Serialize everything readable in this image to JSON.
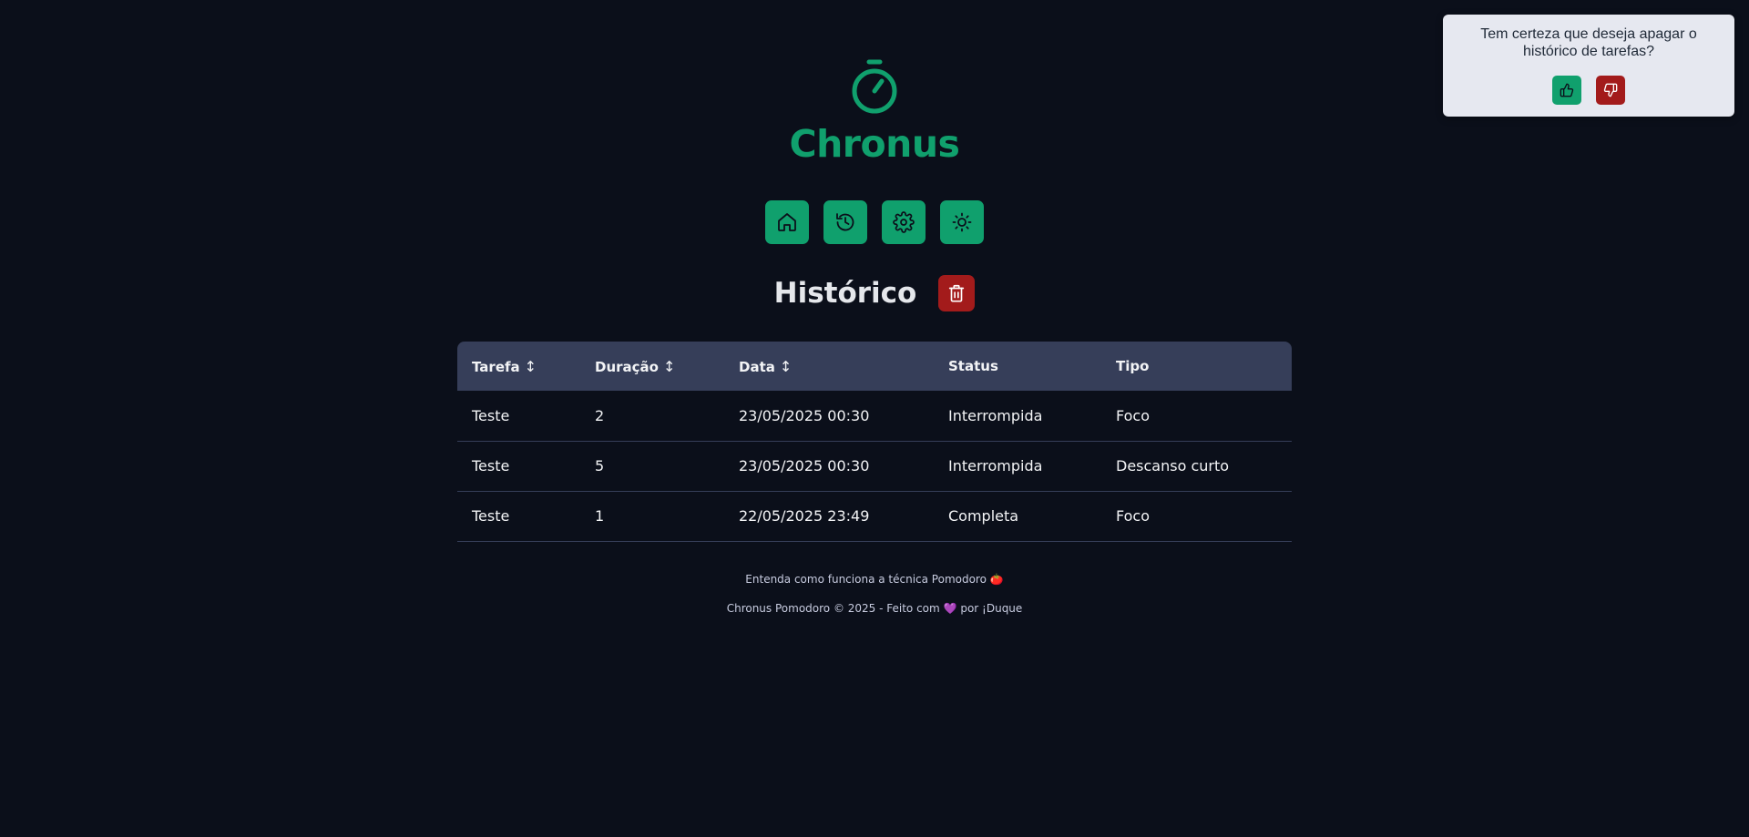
{
  "app": {
    "title": "Chronus",
    "logo_icon": "stopwatch-icon"
  },
  "colors": {
    "background": "#0b0f1a",
    "brand_green": "#10a06d",
    "danger_red": "#a31b1b",
    "table_header": "#363e59",
    "toast_background": "#e6e8f0"
  },
  "nav": {
    "items": [
      {
        "name": "home",
        "icon": "home-icon"
      },
      {
        "name": "history",
        "icon": "history-icon"
      },
      {
        "name": "settings",
        "icon": "gear-icon"
      },
      {
        "name": "theme",
        "icon": "sun-icon"
      }
    ]
  },
  "history": {
    "title": "Histórico",
    "clear_icon": "trash-icon",
    "table": {
      "columns": [
        {
          "label": "Tarefa",
          "sortable": true
        },
        {
          "label": "Duração",
          "sortable": true
        },
        {
          "label": "Data",
          "sortable": true
        },
        {
          "label": "Status",
          "sortable": false
        },
        {
          "label": "Tipo",
          "sortable": false
        }
      ],
      "sort_glyph": "↕",
      "rows": [
        [
          "Teste",
          "2",
          "23/05/2025 00:30",
          "Interrompida",
          "Foco"
        ],
        [
          "Teste",
          "5",
          "23/05/2025 00:30",
          "Interrompida",
          "Descanso curto"
        ],
        [
          "Teste",
          "1",
          "22/05/2025 23:49",
          "Completa",
          "Foco"
        ]
      ]
    }
  },
  "footer": {
    "pomodoro_link": "Entenda como funciona a técnica Pomodoro 🍅",
    "credits_prefix": "Chronus Pomodoro © 2025 - Feito com",
    "heart": "💜",
    "credits_suffix": "por ¡Duque"
  },
  "confirm_toast": {
    "message": "Tem certeza que deseja apagar o histórico de tarefas?",
    "confirm_icon": "thumbs-up-icon",
    "cancel_icon": "thumbs-down-icon"
  }
}
